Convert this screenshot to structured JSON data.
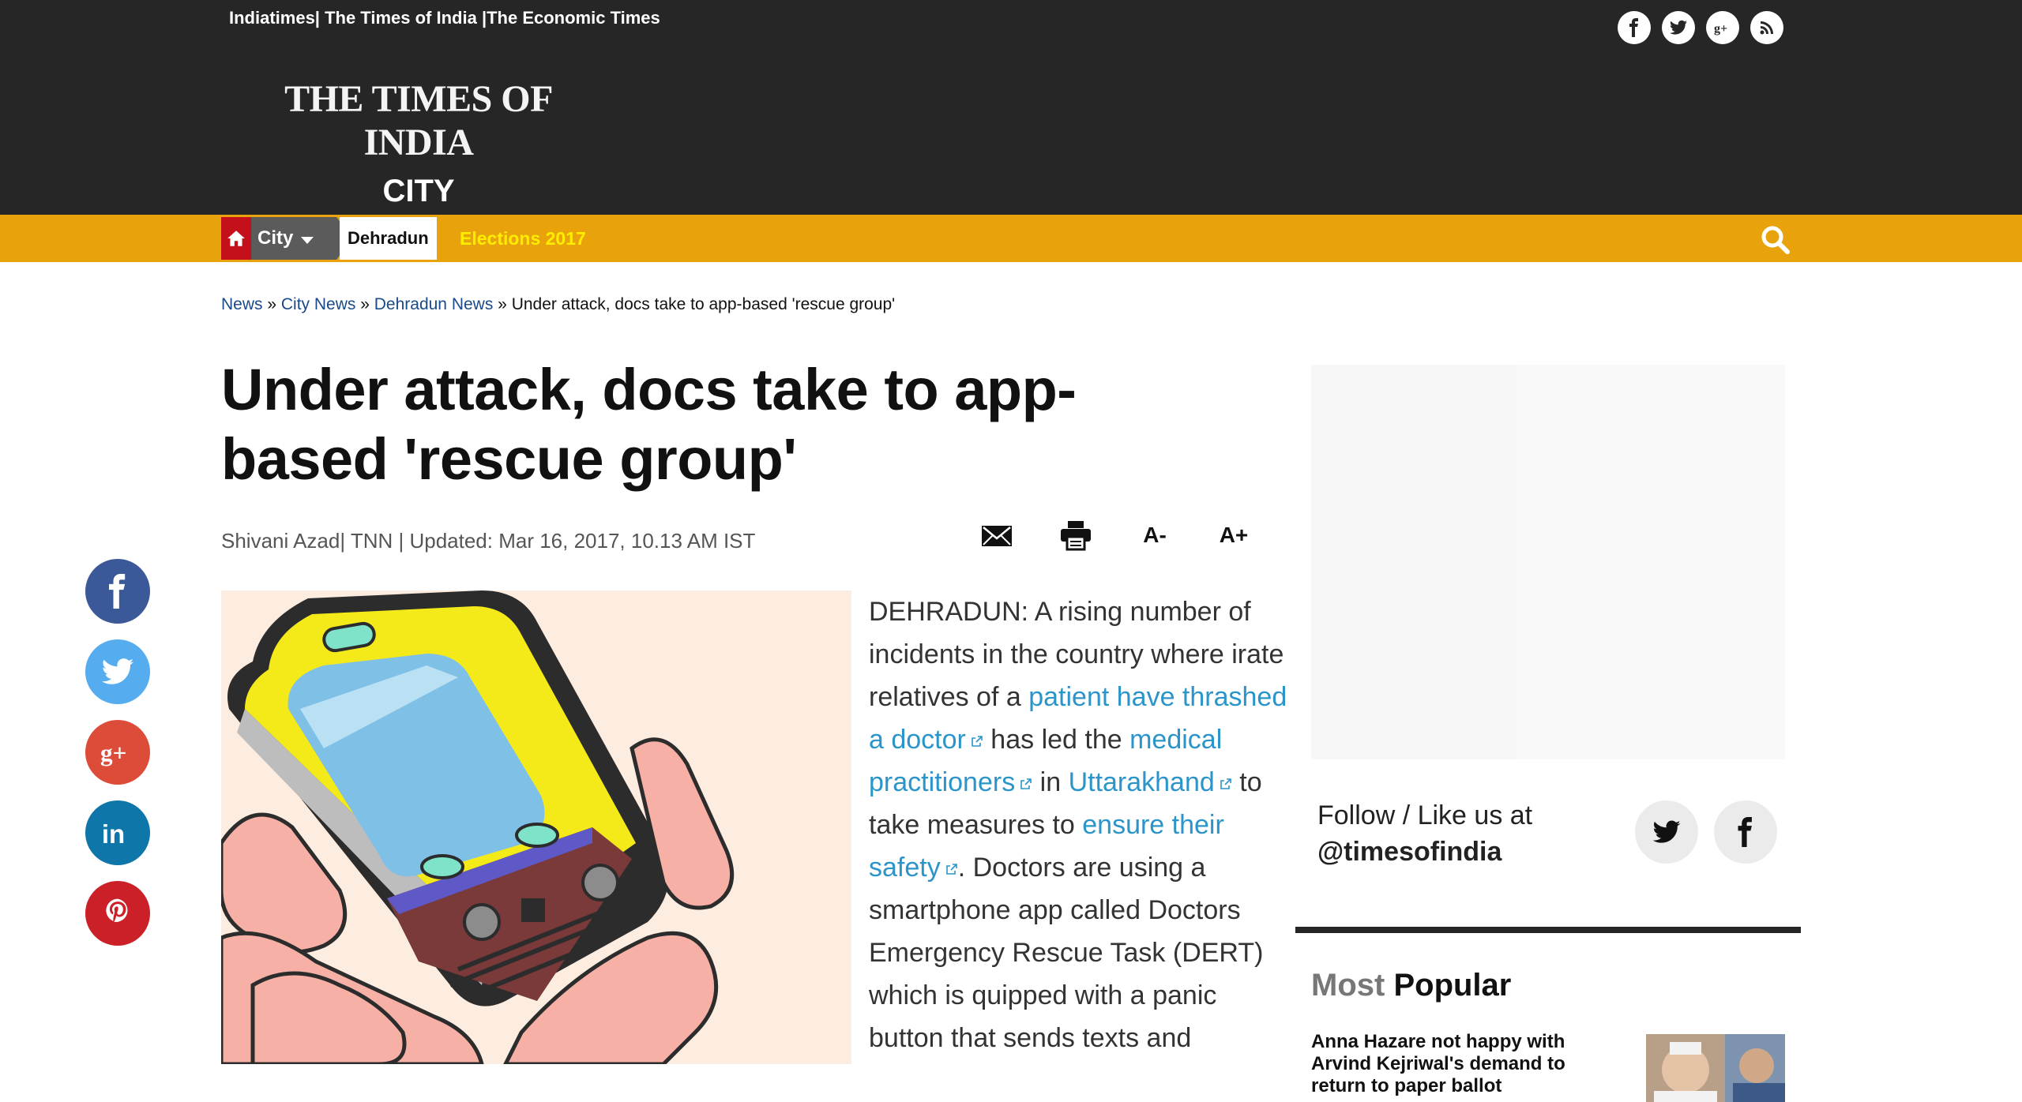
{
  "header": {
    "network_links": [
      "Indiatimes|",
      " The Times of India ",
      "|The Economic Times"
    ],
    "logo_main": "THE TIMES OF INDIA",
    "logo_sub": "CITY",
    "social_icons": [
      "facebook-icon",
      "twitter-icon",
      "google-plus-icon",
      "rss-icon"
    ]
  },
  "nav": {
    "home_icon": "home-icon",
    "city_label": "City",
    "city_current": "Dehradun",
    "elections_label": "Elections 2017",
    "search_icon": "search-icon"
  },
  "breadcrumb": {
    "items": [
      "News",
      "City News",
      "Dehradun News"
    ],
    "separator": " » ",
    "current": "Under attack, docs take to app-based 'rescue group'"
  },
  "article": {
    "headline": "Under attack, docs take to app-based 'rescue group'",
    "byline": "Shivani Azad| TNN | Updated: Mar 16, 2017, 10.13 AM IST",
    "tools": {
      "email_icon": "email-icon",
      "print_icon": "print-icon",
      "font_smaller": "A-",
      "font_larger": "A+"
    },
    "body": {
      "p1": "DEHRADUN: A rising number of incidents in the country where irate relatives of a ",
      "link1": "patient have thrashed a doctor",
      "p2": " has led the ",
      "link2": "medical practitioners",
      "p3": " in ",
      "link3": "Uttarakhand",
      "p4": " to take measures to ",
      "link4": "ensure their safety",
      "p5": ". Doctors are using a smartphone app called Doctors Emergency Rescue Task (DERT) which is quipped with a panic button that sends texts and"
    }
  },
  "share": [
    "facebook-share-icon",
    "twitter-share-icon",
    "google-plus-share-icon",
    "linkedin-share-icon",
    "pinterest-share-icon"
  ],
  "sidebar": {
    "follow_text": "Follow / Like us at",
    "follow_handle": "@timesofindia",
    "most": "Most",
    "popular": "Popular",
    "popular_item_title": "Anna Hazare not happy with Arvind Kejriwal's demand to return to paper ballot"
  },
  "colors": {
    "header_bg": "#262626",
    "nav_bg": "#e8a20c",
    "link_blue": "#2b95c9",
    "elections_yellow": "#ffee00"
  }
}
